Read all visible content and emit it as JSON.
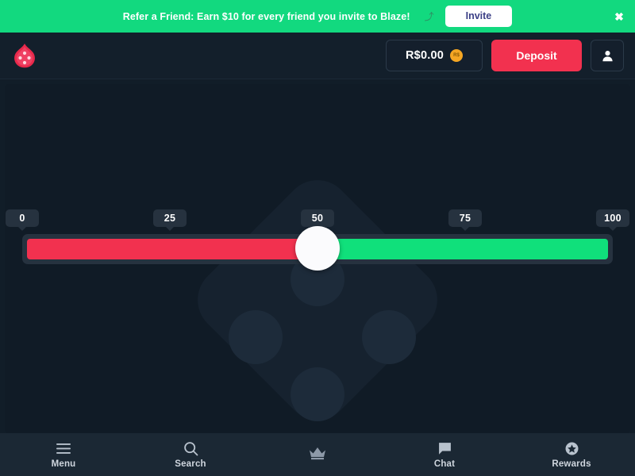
{
  "banner": {
    "text": "Refer a Friend: Earn $10 for every friend you invite to Blaze!",
    "emoji": "⤴",
    "invite_label": "Invite",
    "close_label": "✖",
    "background_color": "#12d97f",
    "invite_text_color": "#3b3f86"
  },
  "header": {
    "logo_name": "blaze-flame-dice-logo",
    "balance": "R$0.00",
    "coin_label": "R$",
    "deposit_label": "Deposit",
    "profile_label": "",
    "deposit_color": "#f2314f",
    "coin_color": "#f5a623"
  },
  "slider": {
    "ticks": [
      {
        "label": "0",
        "percent": 0
      },
      {
        "label": "25",
        "percent": 25
      },
      {
        "label": "50",
        "percent": 50
      },
      {
        "label": "75",
        "percent": 75
      },
      {
        "label": "100",
        "percent": 100
      }
    ],
    "value": 50,
    "min": 0,
    "max": 100,
    "low_color": "#f2314f",
    "high_color": "#10e07b",
    "track_color": "#26323f",
    "handle_color": "#fbfbfd"
  },
  "bottom_nav": {
    "items": [
      {
        "label": "Menu",
        "icon": "hamburger-menu-icon"
      },
      {
        "label": "Search",
        "icon": "search-icon"
      },
      {
        "label": "",
        "icon": "crown-icon"
      },
      {
        "label": "Chat",
        "icon": "chat-bubble-icon"
      },
      {
        "label": "Rewards",
        "icon": "star-badge-icon"
      }
    ]
  },
  "theme": {
    "page_background": "#111d28",
    "stage_background": "#101b26",
    "header_background": "#131f2b",
    "nav_background": "#1b2834"
  }
}
